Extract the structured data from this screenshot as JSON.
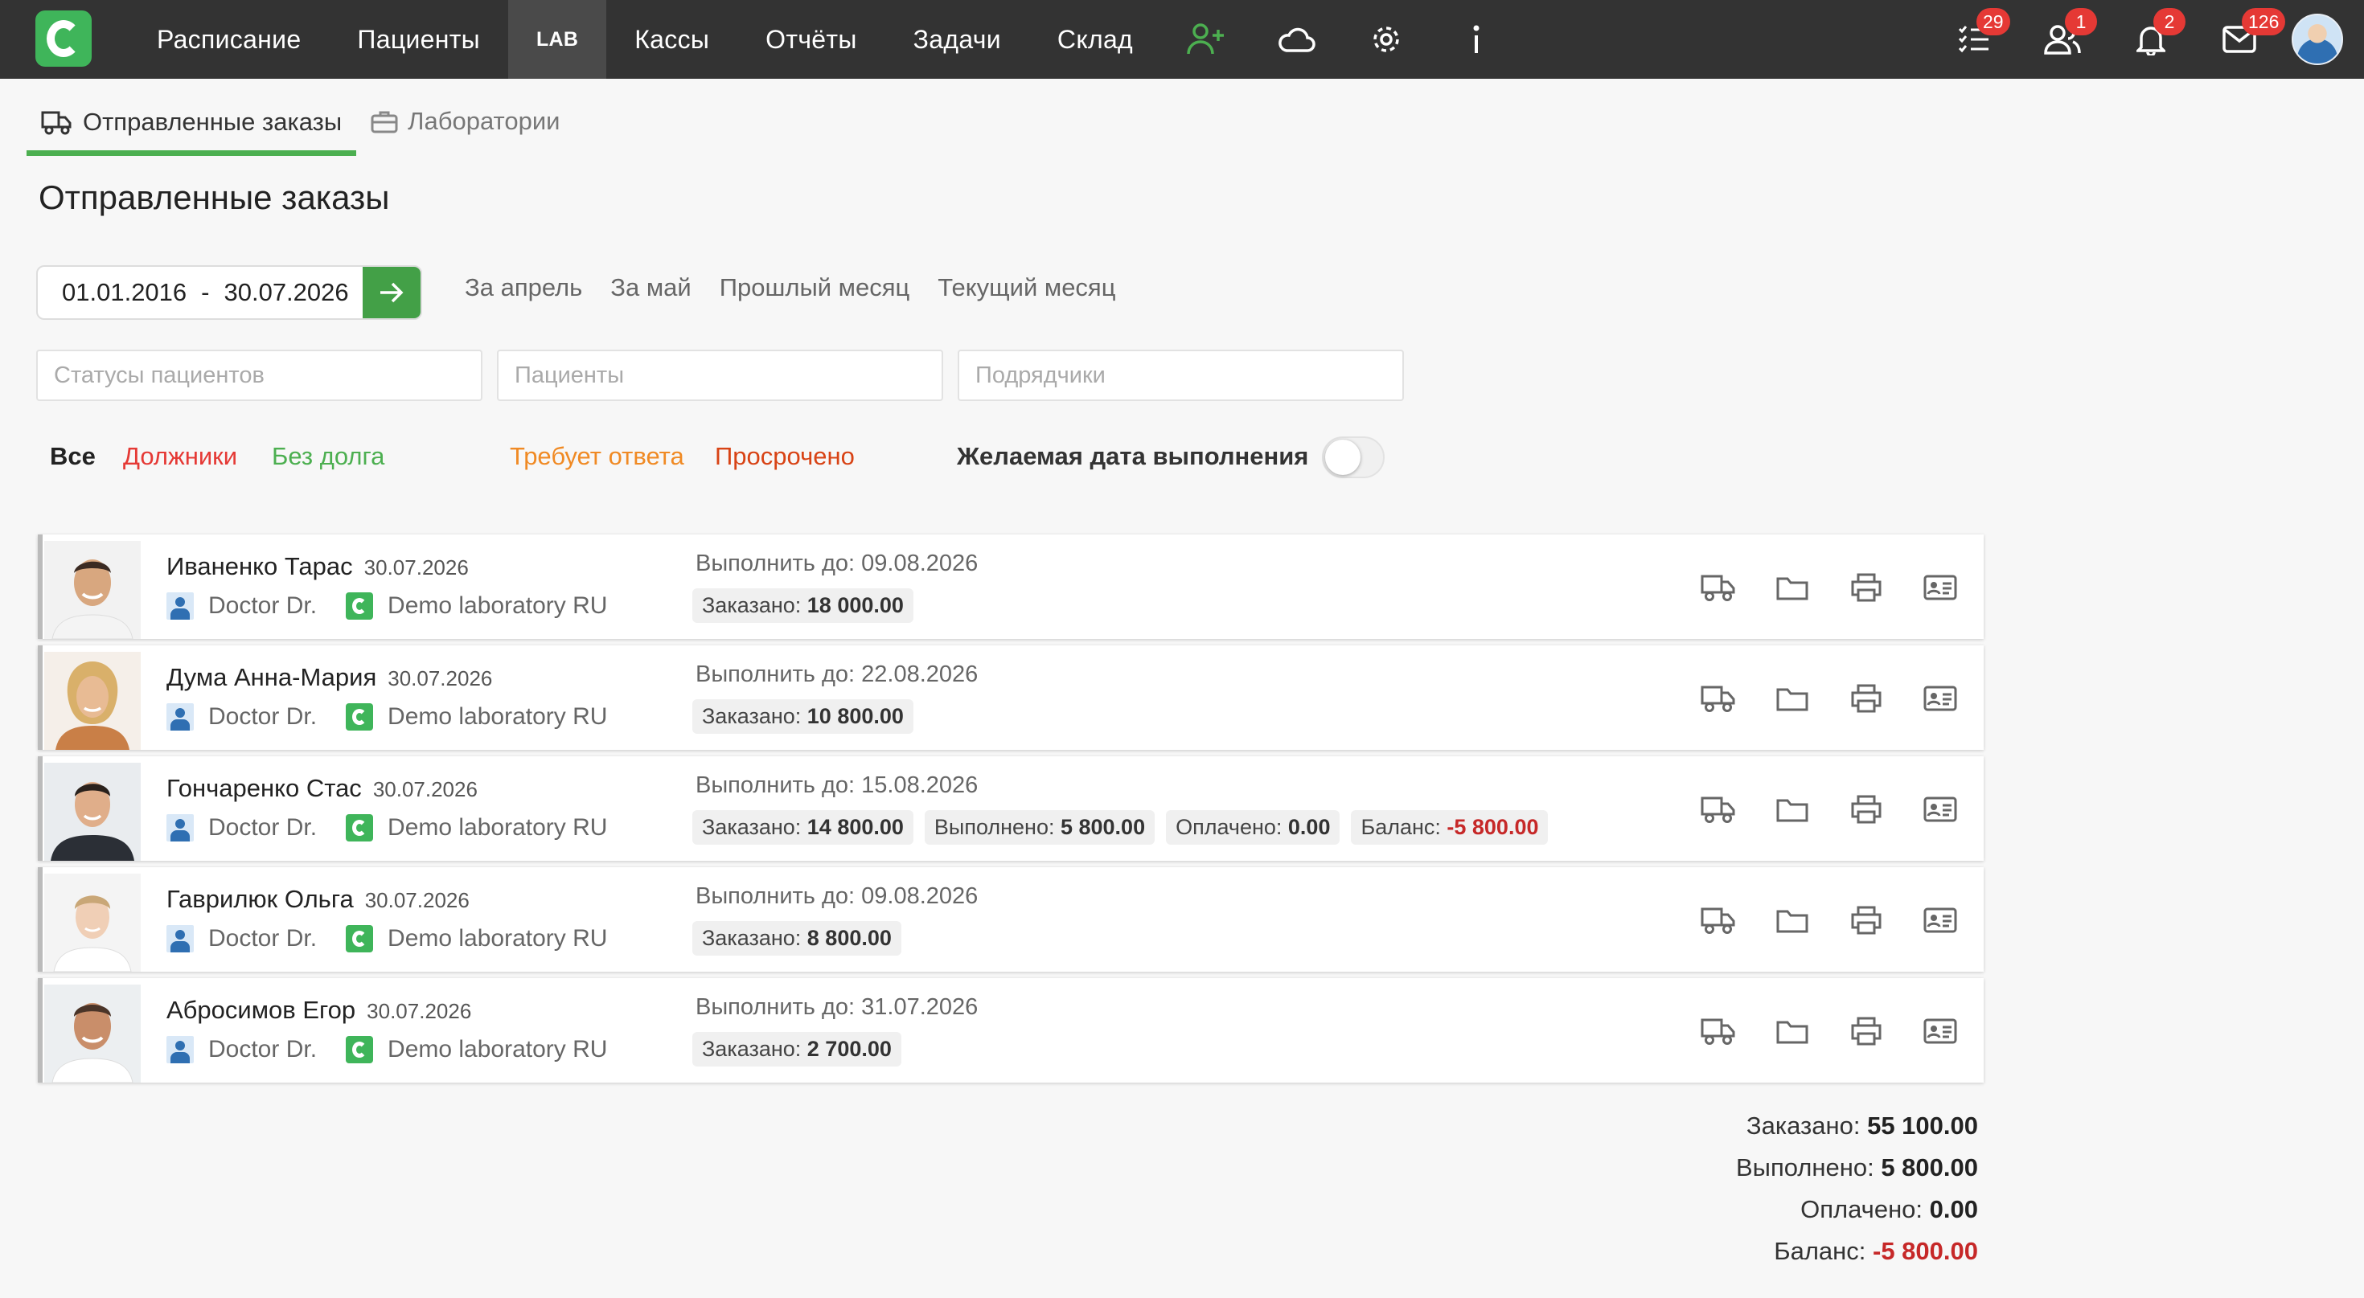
{
  "nav": {
    "items": [
      {
        "label": "Расписание",
        "key": "schedule"
      },
      {
        "label": "Пациенты",
        "key": "patients"
      },
      {
        "label": "LAB",
        "key": "lab",
        "active": true
      },
      {
        "label": "Кассы",
        "key": "cash"
      },
      {
        "label": "Отчёты",
        "key": "reports"
      },
      {
        "label": "Задачи",
        "key": "tasks"
      },
      {
        "label": "Склад",
        "key": "warehouse"
      }
    ],
    "icons": [
      "add-user-icon",
      "cloud-icon",
      "gear-icon",
      "info-icon"
    ],
    "right": [
      {
        "icon": "checklist-icon",
        "badge": "29"
      },
      {
        "icon": "users-icon",
        "badge": "1"
      },
      {
        "icon": "bell-icon",
        "badge": "2"
      },
      {
        "icon": "mail-icon",
        "badge": "126"
      }
    ]
  },
  "subtabs": [
    {
      "label": "Отправленные заказы",
      "icon": "truck-icon",
      "active": true
    },
    {
      "label": "Лаборатории",
      "icon": "briefcase-icon",
      "active": false
    }
  ],
  "page_title": "Отправленные заказы",
  "date_range": {
    "from": "01.01.2016",
    "sep": "-",
    "to": "30.07.2026"
  },
  "presets": [
    "За апрель",
    "За май",
    "Прошлый месяц",
    "Текущий месяц"
  ],
  "filters": {
    "status_placeholder": "Статусы пациентов",
    "patients_placeholder": "Пациенты",
    "contractors_placeholder": "Подрядчики"
  },
  "quick_filters": {
    "all": "Все",
    "debtors": "Должники",
    "no_debt": "Без долга",
    "needs_reply": "Требует ответа",
    "overdue": "Просрочено"
  },
  "toggle": {
    "label": "Желаемая дата выполнения",
    "on": false
  },
  "labels": {
    "due_prefix": "Выполнить до: ",
    "ordered": "Заказано: ",
    "done": "Выполнено: ",
    "paid": "Оплачено: ",
    "balance": "Баланс: "
  },
  "orders": [
    {
      "name": "Иваненко Тарас",
      "date": "30.07.2026",
      "doctor": "Doctor Dr.",
      "lab": "Demo laboratory RU",
      "due": "Выполнить до: 09.08.2026",
      "ordered": "18 000.00"
    },
    {
      "name": "Дума Анна-Мария",
      "date": "30.07.2026",
      "doctor": "Doctor Dr.",
      "lab": "Demo laboratory RU",
      "due": "Выполнить до: 22.08.2026",
      "ordered": "10 800.00"
    },
    {
      "name": "Гончаренко Стас",
      "date": "30.07.2026",
      "doctor": "Doctor Dr.",
      "lab": "Demo laboratory RU",
      "due": "Выполнить до: 15.08.2026",
      "ordered": "14 800.00",
      "done": "5 800.00",
      "paid": "0.00",
      "balance": "-5 800.00"
    },
    {
      "name": "Гаврилюк Ольга",
      "date": "30.07.2026",
      "doctor": "Doctor Dr.",
      "lab": "Demo laboratory RU",
      "due": "Выполнить до: 09.08.2026",
      "ordered": "8 800.00"
    },
    {
      "name": "Абросимов Егор",
      "date": "30.07.2026",
      "doctor": "Doctor Dr.",
      "lab": "Demo laboratory RU",
      "due": "Выполнить до: 31.07.2026",
      "ordered": "2 700.00"
    }
  ],
  "row_actions": [
    "truck-icon",
    "folder-icon",
    "printer-icon",
    "id-card-icon"
  ],
  "totals": {
    "ordered_label": "Заказано: ",
    "ordered": "55 100.00",
    "done_label": "Выполнено: ",
    "done": "5 800.00",
    "paid_label": "Оплачено: ",
    "paid": "0.00",
    "balance_label": "Баланс: ",
    "balance": "-5 800.00"
  },
  "colors": {
    "nav_bg": "#333333",
    "accent_green": "#43a047",
    "debt_red": "#e53935",
    "no_debt_green": "#4caf50",
    "needs_reply_orange": "#f08a24",
    "overdue_red": "#d84315",
    "negative_red": "#c62828"
  }
}
